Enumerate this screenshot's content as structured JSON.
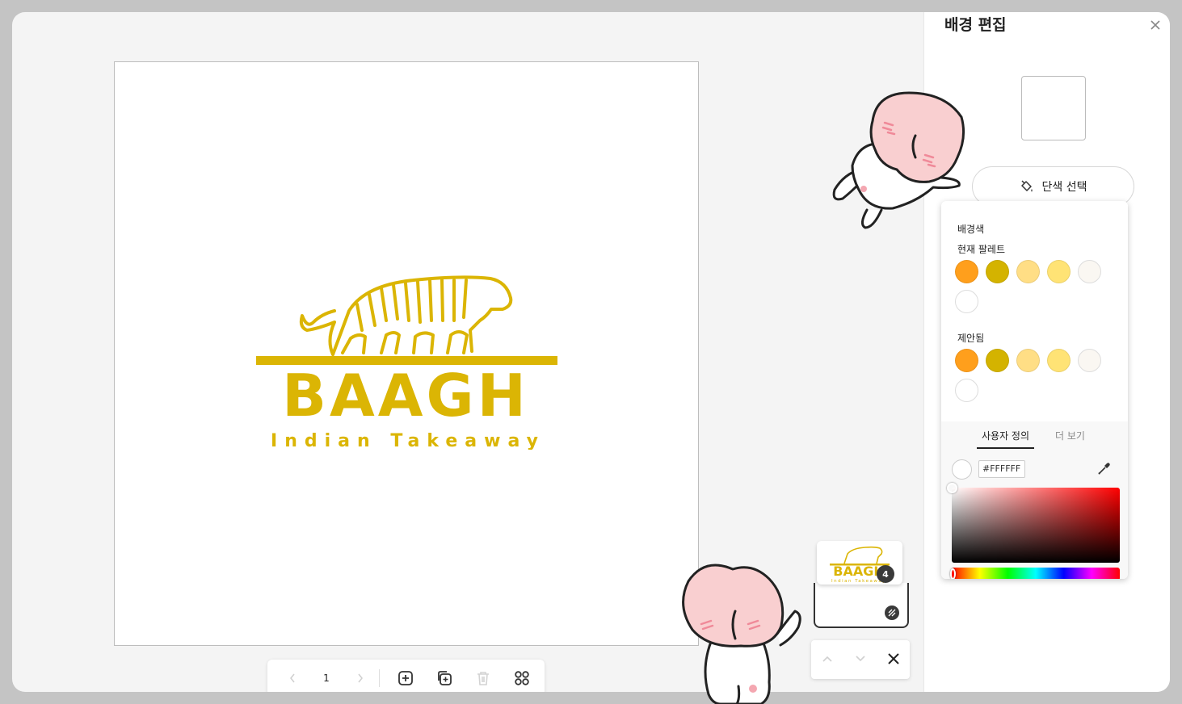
{
  "panel": {
    "title": "배경 편집",
    "solid_button_label": "단색 선택"
  },
  "color_popover": {
    "background_label": "배경색",
    "current_palette_label": "현재 팔레트",
    "current_palette": [
      "#FF9F1C",
      "#D4B300",
      "#FFDE85",
      "#FFE375",
      "#FAF7F2",
      "#FFFFFF"
    ],
    "suggested_label": "제안됨",
    "suggested": [
      "#FF9F1C",
      "#D4B300",
      "#FFDE85",
      "#FFE375",
      "#FAF7F2",
      "#FFFFFF"
    ],
    "tab_custom": "사용자 정의",
    "tab_more": "더 보기",
    "hex_value": "#FFFFFF"
  },
  "logo": {
    "name": "BAAGH",
    "tagline": "Indian Takeaway",
    "color": "#DBB504"
  },
  "page_toolbar": {
    "page_number": "1"
  },
  "layers": {
    "count": "4"
  }
}
